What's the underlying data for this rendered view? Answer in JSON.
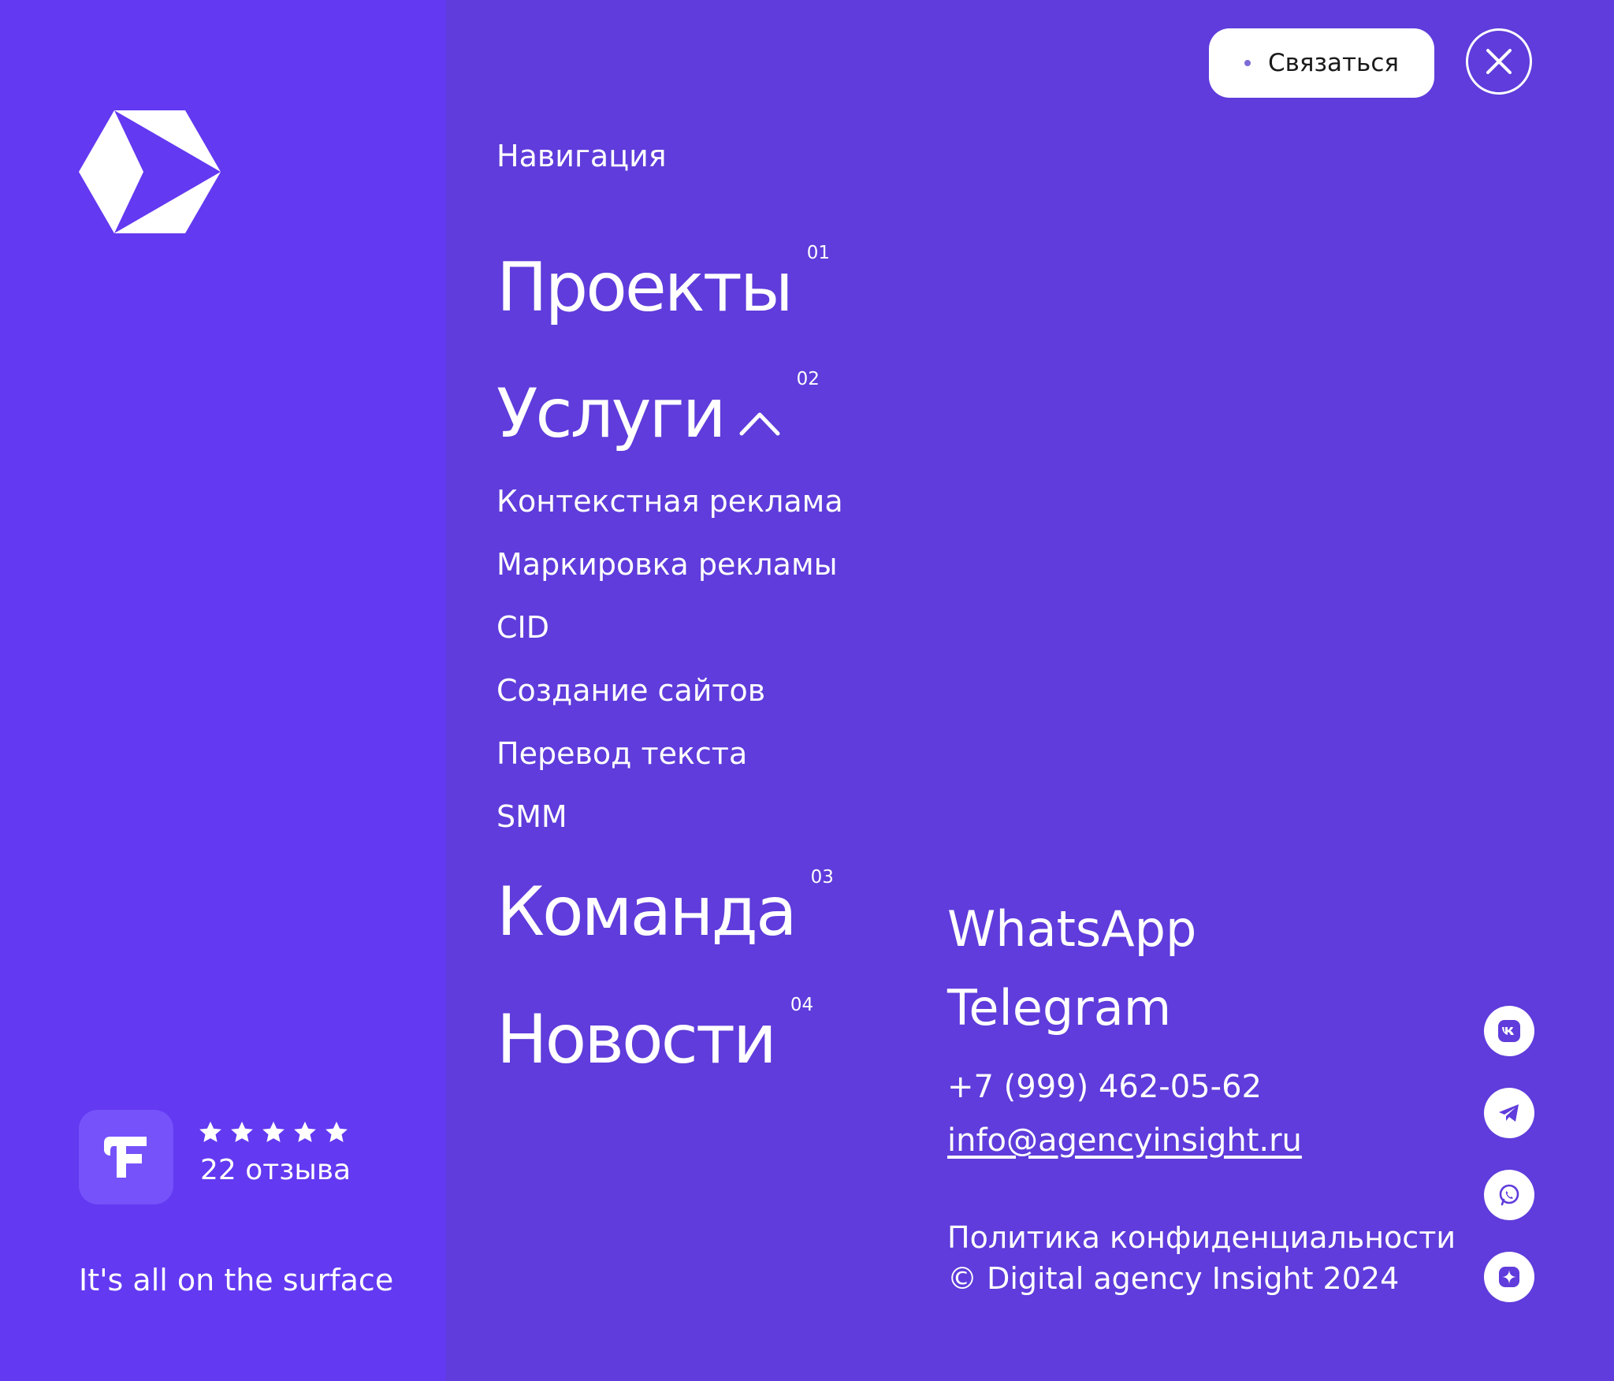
{
  "header": {
    "contact_label": "Связаться"
  },
  "brand": {
    "tagline": "It's all on the surface"
  },
  "rating": {
    "stars": 5,
    "reviews_label": "22 отзыва"
  },
  "nav": {
    "label": "Навигация",
    "items": [
      {
        "label": "Проекты",
        "num": "01"
      },
      {
        "label": "Услуги",
        "num": "02",
        "expanded": true
      },
      {
        "label": "Команда",
        "num": "03"
      },
      {
        "label": "Новости",
        "num": "04"
      }
    ],
    "services": [
      "Контекстная реклама",
      "Маркировка рекламы",
      "CID",
      "Создание сайтов",
      "Перевод текста",
      "SMM"
    ]
  },
  "contacts": {
    "whatsapp": "WhatsApp",
    "telegram": "Telegram",
    "phone": "+7 (999) 462-05-62",
    "email": "info@agencyinsight.ru"
  },
  "footer": {
    "policy": "Политика конфиденциальности",
    "copyright": "© Digital agency Insight 2024"
  },
  "social_icons": [
    "vk-icon",
    "telegram-icon",
    "whatsapp-icon",
    "dzen-icon"
  ],
  "colors": {
    "left_bg": "#6339f1",
    "main_bg": "#5f3cdb",
    "badge_bg": "#7652fb",
    "text": "#ffffff"
  }
}
